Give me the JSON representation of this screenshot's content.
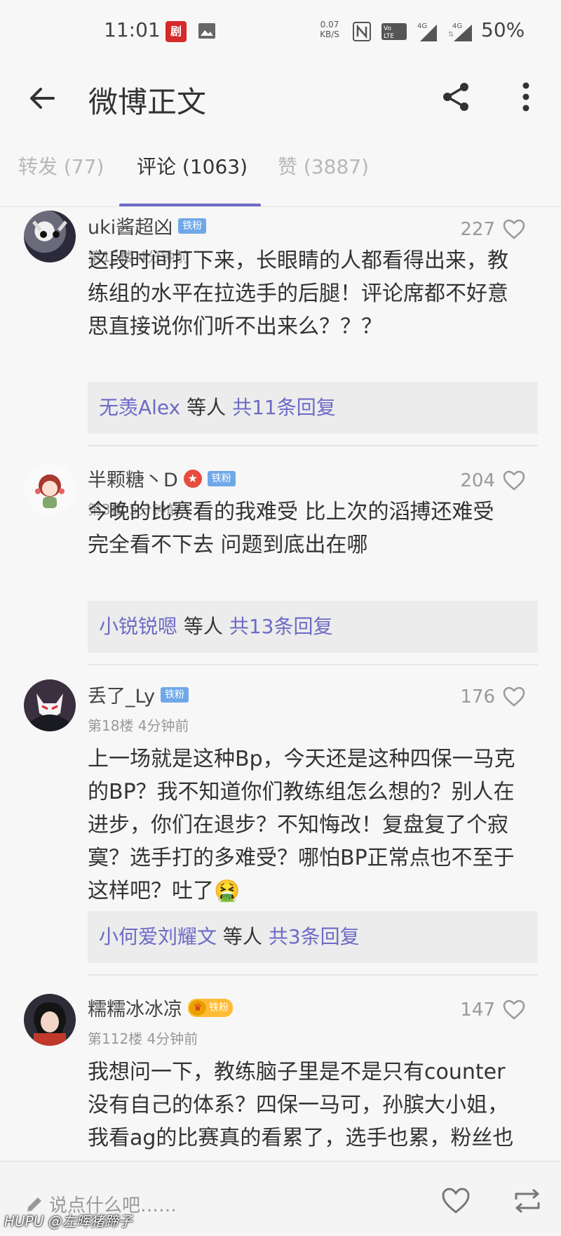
{
  "status_bar": {
    "time": "11:01",
    "net_speed_value": "0.07",
    "net_speed_unit": "KB/S",
    "battery": "50%",
    "icons": [
      "app-icon",
      "gallery-icon",
      "nfc-icon",
      "volte-icon",
      "signal-4g-icon",
      "signal-4g-icon"
    ]
  },
  "header": {
    "title": "微博正文"
  },
  "tabs": [
    {
      "label": "转发 (77)"
    },
    {
      "label": "评论 (1063)"
    },
    {
      "label": "赞 (3887)"
    }
  ],
  "comments": [
    {
      "username": "uki酱超凶",
      "badge": "铁粉",
      "meta": "第15楼 4分钟前",
      "likes": "227",
      "lines": [
        "这段时间打下来，长眼睛的人都看得出来，教",
        "练组的水平在拉选手的后腿！评论席都不好意",
        "思直接说你们听不出来么？？？"
      ],
      "reply": {
        "user": "无羡Alex",
        "mid": " 等人 ",
        "count": "共11条回复"
      }
    },
    {
      "username": "半颗糖丶D",
      "badge": "铁粉",
      "meta": "第3楼 5分钟前",
      "likes": "204",
      "lines": [
        "今晚的比赛看的我难受 比上次的滔搏还难受",
        "完全看不下去 问题到底出在哪"
      ],
      "reply": {
        "user": "小锐锐嗯",
        "mid": " 等人 ",
        "count": "共13条回复"
      }
    },
    {
      "username": "丢了_Ly",
      "badge": "铁粉",
      "meta": "第18楼 4分钟前",
      "likes": "176",
      "lines": [
        "上一场就是这种Bp，今天还是这种四保一马克",
        "的BP？我不知道你们教练组怎么想的？别人在",
        "进步，你们在退步？不知悔改！复盘复了个寂",
        "寞？选手打的多难受？哪怕BP正常点也不至于",
        "这样吧？吐了🤮"
      ],
      "reply": {
        "user": "小何爱刘耀文",
        "mid": " 等人 ",
        "count": "共3条回复"
      }
    },
    {
      "username": "糯糯冰冰凉",
      "badge": "铁粉",
      "meta": "第112楼 4分钟前",
      "likes": "147",
      "lines": [
        "我想问一下，教练脑子里是不是只有counter",
        "没有自己的体系？四保一马可，孙膑大小姐，",
        "我看ag的比赛真的看累了，选手也累，粉丝也"
      ]
    }
  ],
  "bottom_bar": {
    "placeholder": "说点什么吧……",
    "watermark": "HUPU @左晖猪蹄子"
  }
}
